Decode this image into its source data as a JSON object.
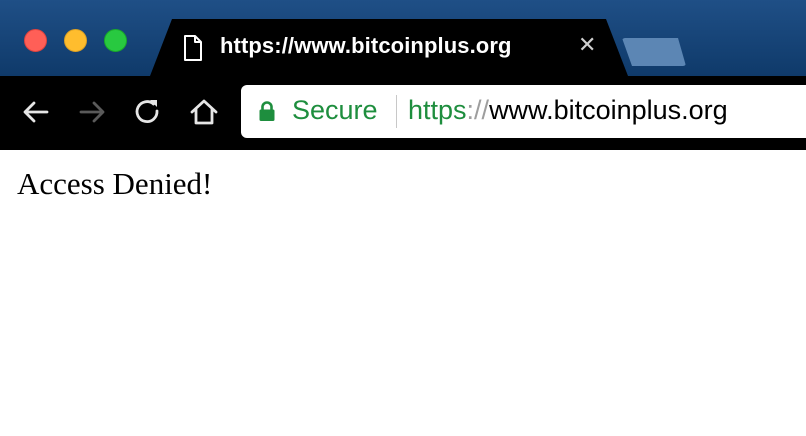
{
  "window": {
    "controls": [
      "close",
      "minimize",
      "maximize"
    ]
  },
  "tab": {
    "title": "https://www.bitcoinplus.org",
    "icon": "page-icon",
    "close_glyph": "✕"
  },
  "toolbar": {
    "icons": [
      "back-arrow-icon",
      "forward-arrow-icon",
      "reload-icon",
      "home-icon"
    ]
  },
  "omnibox": {
    "security_label": "Secure",
    "lock_icon": "lock-icon",
    "url_scheme": "https",
    "url_separator": "://",
    "url_host": "www.bitcoinplus.org"
  },
  "page": {
    "message": "Access Denied!"
  },
  "colors": {
    "tab_strip": "#1f4f86",
    "toolbar": "#000000",
    "secure_green": "#1e8e3e"
  }
}
